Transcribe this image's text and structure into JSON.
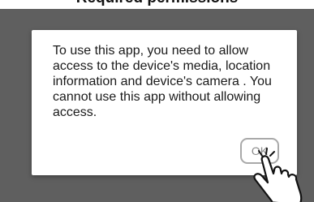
{
  "header": {
    "title": "Required permissions"
  },
  "dialog": {
    "message": "To use this app, you need to allow access to the device's media, location information and device's camera . You cannot use this app without allowing access.",
    "ok_label": "OK"
  },
  "icons": {
    "pointer": "hand-pointer-icon"
  },
  "colors": {
    "backdrop": "#5f5f5f",
    "dialog_background": "#ffffff",
    "button_border": "#a9a9a9"
  }
}
